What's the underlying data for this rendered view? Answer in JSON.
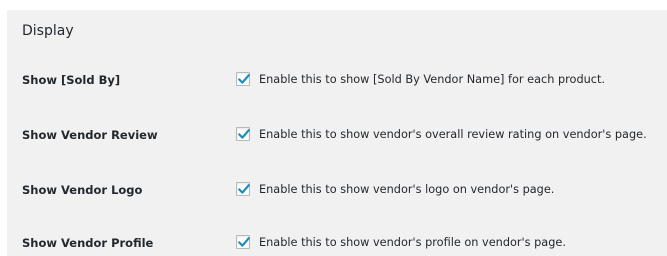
{
  "section": {
    "title": "Display"
  },
  "settings": [
    {
      "label": "Show [Sold By]",
      "checked": true,
      "description": "Enable this to show [Sold By Vendor Name] for each product."
    },
    {
      "label": "Show Vendor Review",
      "checked": true,
      "description": "Enable this to show vendor's overall review rating on vendor's page."
    },
    {
      "label": "Show Vendor Logo",
      "checked": true,
      "description": "Enable this to show vendor's logo on vendor's page."
    },
    {
      "label": "Show Vendor Profile",
      "checked": true,
      "description": "Enable this to show vendor's profile on vendor's page."
    }
  ],
  "colors": {
    "panel_background": "#f1f1f1",
    "checkmark": "#1e8cbe",
    "text": "#23282d"
  }
}
